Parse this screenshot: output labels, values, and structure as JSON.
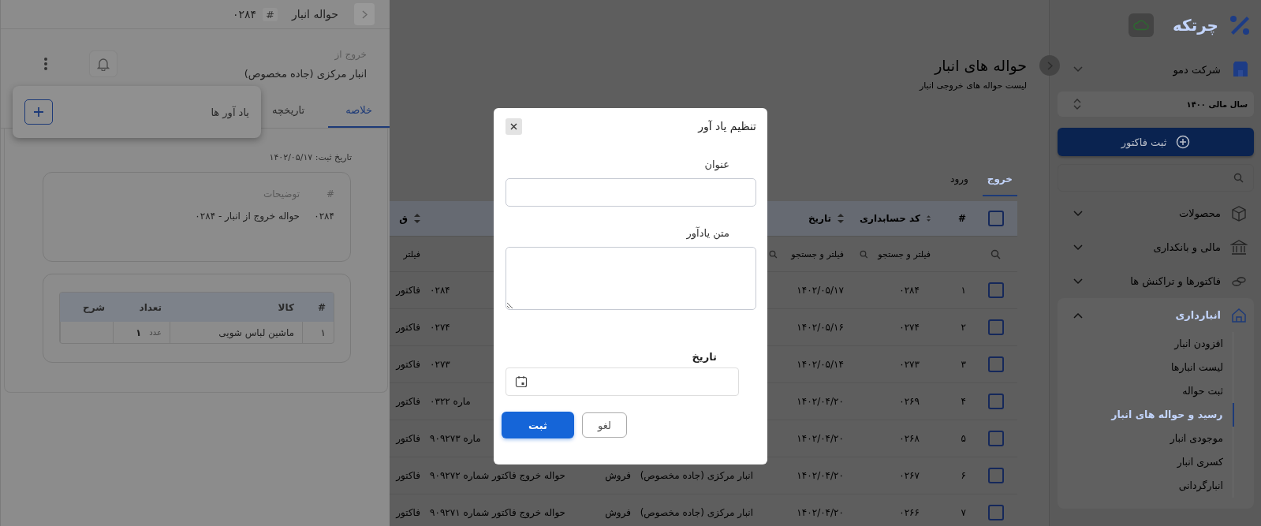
{
  "sidebar": {
    "logo": "چرتکه",
    "company": "شرکت دمو",
    "fiscal_year": "سال مالی ۱۴۰۰",
    "new_invoice_button": "ثبت فاکتور",
    "menu": [
      {
        "label": "محصولات",
        "expanded": false
      },
      {
        "label": "مالی و بانکداری",
        "expanded": false
      },
      {
        "label": "فاکتورها و تراکنش ها",
        "expanded": false
      },
      {
        "label": "انبارداری",
        "expanded": true,
        "children": [
          {
            "label": "افزودن انبار",
            "selected": false
          },
          {
            "label": "لیست انبارها",
            "selected": false
          },
          {
            "label": "ثبت حواله",
            "selected": false
          },
          {
            "label": "رسید و حواله های انبار",
            "selected": true
          },
          {
            "label": "موجودی انبار",
            "selected": false
          },
          {
            "label": "کسری انبار",
            "selected": false
          },
          {
            "label": "انبارگردانی",
            "selected": false
          }
        ]
      }
    ]
  },
  "main": {
    "title": "حواله های انبار",
    "subtitle": "لیست حواله های خروجی انبار",
    "tabs": [
      {
        "label": "خروج",
        "selected": true
      },
      {
        "label": "ورود",
        "selected": false
      }
    ],
    "table": {
      "select_all_checked": false,
      "headers": {
        "number": {
          "label": "#"
        },
        "code": {
          "label": "کد حسابداری",
          "sortable": true
        },
        "date": {
          "label": "تاریخ",
          "sortable": true
        },
        "column_8": {
          "label": "ق",
          "sortable": true
        }
      },
      "filters": {
        "code": {
          "placeholder": "فیلتر و جستجو"
        },
        "date": {
          "placeholder": "فیلتر و جستجو"
        },
        "column_8": {
          "placeholder": "فیلتر"
        }
      },
      "rows": [
        {
          "checked": false,
          "number": "۱",
          "code": "۰۲۸۴",
          "date": "۱۴۰۲/۰۵/۱۷",
          "description": "۰۲۸۴",
          "column_8": "فاکتور"
        },
        {
          "checked": false,
          "number": "۲",
          "code": "۰۲۷۴",
          "date": "۱۴۰۲/۰۵/۱۶",
          "description": "۰۲۷۴",
          "column_8": "فاکتور"
        },
        {
          "checked": false,
          "number": "۳",
          "code": "۰۲۷۳",
          "date": "۱۴۰۲/۰۵/۱۴",
          "description": "۰۲۷۳",
          "column_8": "فاکتور"
        },
        {
          "checked": false,
          "number": "۴",
          "code": "۰۲۶۹",
          "date": "۱۴۰۲/۰۴/۲۰",
          "description": "ماره ۰۳۲۲",
          "column_8": "فاکتور"
        },
        {
          "checked": false,
          "number": "۵",
          "code": "۰۲۶۸",
          "date": "۱۴۰۲/۰۴/۲۰",
          "description": "ماره ۹۰۹۲۷۳",
          "column_8": "فاکتور"
        },
        {
          "checked": false,
          "number": "۶",
          "code": "۰۲۶۷",
          "date": "۱۴۰۲/۰۴/۲۰",
          "warehouse": "انبار مرکزی (جاده مخصوص)",
          "type": "فروش",
          "description": "حواله خروج فاکتور شماره ۹۰۹۲۷۲",
          "column_8": "فاکتور"
        },
        {
          "checked": false,
          "number": "۷",
          "code": "۰۲۶۶",
          "date": "۱۴۰۲/۰۴/۲۰",
          "warehouse": "انبار مرکزی (جاده مخصوص)",
          "type": "فروش",
          "description": "حواله خروج فاکتور شماره ۹۰۹۲۷۱",
          "column_8": "فاکتور"
        }
      ]
    }
  },
  "drawer": {
    "title": "حواله انبار",
    "hash": "#",
    "number": "۰۲۸۴",
    "source_label": "خروج از",
    "source": "انبار مرکزی (جاده مخصوص)",
    "tabs": [
      {
        "label": "خلاصه",
        "selected": true
      },
      {
        "label": "تاریخچه",
        "selected": false
      }
    ],
    "reminders_popup": {
      "title": "یاد آور ها"
    },
    "registered": "تاریخ ثبت: ۱۴۰۲/۰۵/۱۷",
    "notes": {
      "columns": [
        "#",
        "توضیحات"
      ],
      "row": [
        "۰۲۸۴",
        "حواله خروج از انبار - ۰۲۸۴"
      ]
    },
    "items": {
      "columns": [
        "#",
        "کالا",
        "تعداد",
        "شرح"
      ],
      "rows": [
        {
          "number": "۱",
          "product": "ماشین لباس شویی",
          "unit": "عدد",
          "quantity": "۱"
        }
      ]
    }
  },
  "dialog": {
    "title": "تنظیم یاد آور",
    "fields": [
      {
        "kind": "text",
        "label": "عنوان"
      },
      {
        "kind": "textarea",
        "label": "متن یادآور"
      },
      {
        "kind": "date",
        "label": "تاریخ"
      }
    ],
    "buttons": [
      {
        "kind": "secondary",
        "label": "لغو"
      },
      {
        "kind": "primary",
        "label": "ثبت"
      }
    ]
  }
}
